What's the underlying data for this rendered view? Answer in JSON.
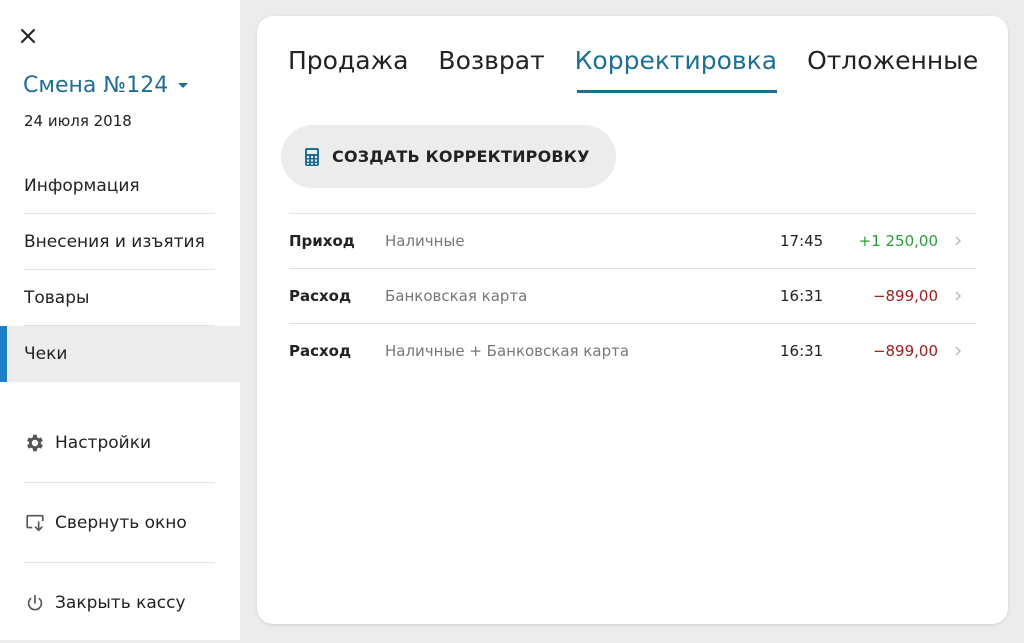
{
  "sidebar": {
    "shift_title": "Смена №124",
    "shift_date": "24 июля 2018",
    "nav": [
      {
        "label": "Информация",
        "active": false
      },
      {
        "label": "Внесения и изъятия",
        "active": false
      },
      {
        "label": "Товары",
        "active": false
      },
      {
        "label": "Чеки",
        "active": true
      }
    ],
    "bottom": [
      {
        "label": "Настройки",
        "icon": "gear-icon"
      },
      {
        "label": "Свернуть окно",
        "icon": "minimize-window-icon"
      },
      {
        "label": "Закрыть кассу",
        "icon": "power-icon"
      }
    ]
  },
  "tabs": [
    {
      "label": "Продажа",
      "active": false
    },
    {
      "label": "Возврат",
      "active": false
    },
    {
      "label": "Корректировка",
      "active": true
    },
    {
      "label": "Отложенные",
      "active": false
    }
  ],
  "create_button": {
    "label": "СОЗДАТЬ КОРРЕКТИРОВКУ",
    "icon": "calculator-icon"
  },
  "rows": [
    {
      "kind": "Приход",
      "method": "Наличные",
      "time": "17:45",
      "amount": "+1 250,00",
      "sign": "positive"
    },
    {
      "kind": "Расход",
      "method": "Банковская карта",
      "time": "16:31",
      "amount": "−899,00",
      "sign": "negative"
    },
    {
      "kind": "Расход",
      "method": "Наличные + Банковская карта",
      "time": "16:31",
      "amount": "−899,00",
      "sign": "negative"
    }
  ],
  "colors": {
    "accent": "#1f6f94",
    "active_marker": "#1f7fc4",
    "positive": "#2e9a3a",
    "negative": "#a01e1e"
  }
}
